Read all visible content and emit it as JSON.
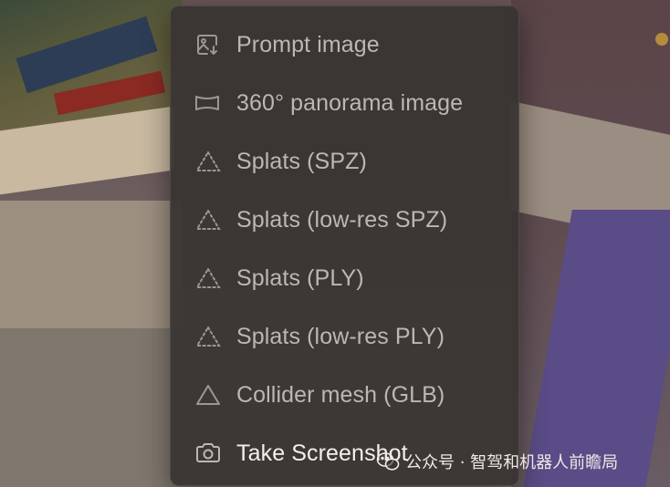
{
  "menu": {
    "items": [
      {
        "label": "Prompt image",
        "icon": "image-download-icon"
      },
      {
        "label": "360° panorama image",
        "icon": "panorama-icon"
      },
      {
        "label": "Splats (SPZ)",
        "icon": "dotted-triangle-icon"
      },
      {
        "label": "Splats (low-res SPZ)",
        "icon": "dotted-triangle-icon"
      },
      {
        "label": "Splats (PLY)",
        "icon": "dotted-triangle-icon"
      },
      {
        "label": "Splats (low-res PLY)",
        "icon": "dotted-triangle-icon"
      },
      {
        "label": "Collider mesh (GLB)",
        "icon": "triangle-icon"
      },
      {
        "label": "Take Screenshot",
        "icon": "camera-icon"
      }
    ]
  },
  "watermark": {
    "text": "公众号 · 智驾和机器人前瞻局"
  },
  "colors": {
    "menu_bg": "#383432",
    "label": "#bdb7b2",
    "label_active": "#f3f0ec",
    "icon": "#9d9792"
  }
}
